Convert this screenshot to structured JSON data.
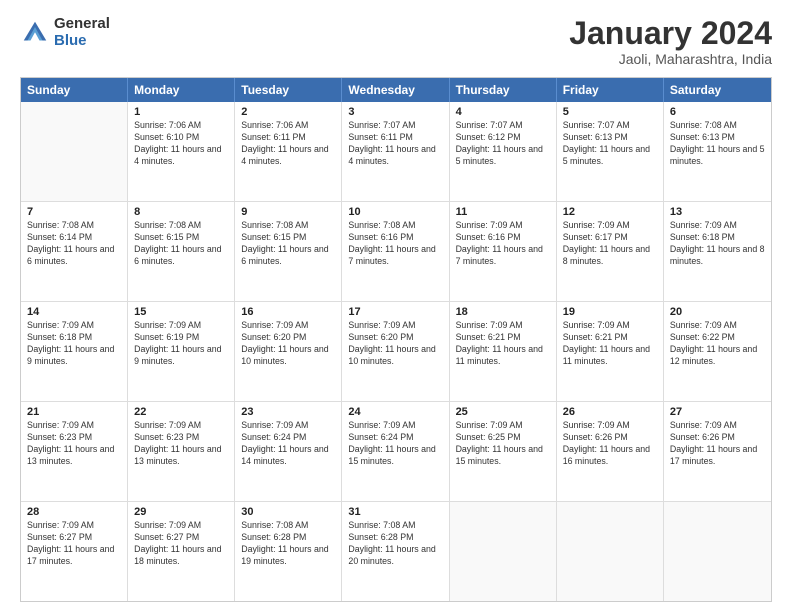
{
  "logo": {
    "general": "General",
    "blue": "Blue"
  },
  "header": {
    "month_year": "January 2024",
    "location": "Jaoli, Maharashtra, India"
  },
  "weekdays": [
    "Sunday",
    "Monday",
    "Tuesday",
    "Wednesday",
    "Thursday",
    "Friday",
    "Saturday"
  ],
  "rows": [
    [
      {
        "day": "",
        "sunrise": "",
        "sunset": "",
        "daylight": ""
      },
      {
        "day": "1",
        "sunrise": "Sunrise: 7:06 AM",
        "sunset": "Sunset: 6:10 PM",
        "daylight": "Daylight: 11 hours and 4 minutes."
      },
      {
        "day": "2",
        "sunrise": "Sunrise: 7:06 AM",
        "sunset": "Sunset: 6:11 PM",
        "daylight": "Daylight: 11 hours and 4 minutes."
      },
      {
        "day": "3",
        "sunrise": "Sunrise: 7:07 AM",
        "sunset": "Sunset: 6:11 PM",
        "daylight": "Daylight: 11 hours and 4 minutes."
      },
      {
        "day": "4",
        "sunrise": "Sunrise: 7:07 AM",
        "sunset": "Sunset: 6:12 PM",
        "daylight": "Daylight: 11 hours and 5 minutes."
      },
      {
        "day": "5",
        "sunrise": "Sunrise: 7:07 AM",
        "sunset": "Sunset: 6:13 PM",
        "daylight": "Daylight: 11 hours and 5 minutes."
      },
      {
        "day": "6",
        "sunrise": "Sunrise: 7:08 AM",
        "sunset": "Sunset: 6:13 PM",
        "daylight": "Daylight: 11 hours and 5 minutes."
      }
    ],
    [
      {
        "day": "7",
        "sunrise": "Sunrise: 7:08 AM",
        "sunset": "Sunset: 6:14 PM",
        "daylight": "Daylight: 11 hours and 6 minutes."
      },
      {
        "day": "8",
        "sunrise": "Sunrise: 7:08 AM",
        "sunset": "Sunset: 6:15 PM",
        "daylight": "Daylight: 11 hours and 6 minutes."
      },
      {
        "day": "9",
        "sunrise": "Sunrise: 7:08 AM",
        "sunset": "Sunset: 6:15 PM",
        "daylight": "Daylight: 11 hours and 6 minutes."
      },
      {
        "day": "10",
        "sunrise": "Sunrise: 7:08 AM",
        "sunset": "Sunset: 6:16 PM",
        "daylight": "Daylight: 11 hours and 7 minutes."
      },
      {
        "day": "11",
        "sunrise": "Sunrise: 7:09 AM",
        "sunset": "Sunset: 6:16 PM",
        "daylight": "Daylight: 11 hours and 7 minutes."
      },
      {
        "day": "12",
        "sunrise": "Sunrise: 7:09 AM",
        "sunset": "Sunset: 6:17 PM",
        "daylight": "Daylight: 11 hours and 8 minutes."
      },
      {
        "day": "13",
        "sunrise": "Sunrise: 7:09 AM",
        "sunset": "Sunset: 6:18 PM",
        "daylight": "Daylight: 11 hours and 8 minutes."
      }
    ],
    [
      {
        "day": "14",
        "sunrise": "Sunrise: 7:09 AM",
        "sunset": "Sunset: 6:18 PM",
        "daylight": "Daylight: 11 hours and 9 minutes."
      },
      {
        "day": "15",
        "sunrise": "Sunrise: 7:09 AM",
        "sunset": "Sunset: 6:19 PM",
        "daylight": "Daylight: 11 hours and 9 minutes."
      },
      {
        "day": "16",
        "sunrise": "Sunrise: 7:09 AM",
        "sunset": "Sunset: 6:20 PM",
        "daylight": "Daylight: 11 hours and 10 minutes."
      },
      {
        "day": "17",
        "sunrise": "Sunrise: 7:09 AM",
        "sunset": "Sunset: 6:20 PM",
        "daylight": "Daylight: 11 hours and 10 minutes."
      },
      {
        "day": "18",
        "sunrise": "Sunrise: 7:09 AM",
        "sunset": "Sunset: 6:21 PM",
        "daylight": "Daylight: 11 hours and 11 minutes."
      },
      {
        "day": "19",
        "sunrise": "Sunrise: 7:09 AM",
        "sunset": "Sunset: 6:21 PM",
        "daylight": "Daylight: 11 hours and 11 minutes."
      },
      {
        "day": "20",
        "sunrise": "Sunrise: 7:09 AM",
        "sunset": "Sunset: 6:22 PM",
        "daylight": "Daylight: 11 hours and 12 minutes."
      }
    ],
    [
      {
        "day": "21",
        "sunrise": "Sunrise: 7:09 AM",
        "sunset": "Sunset: 6:23 PM",
        "daylight": "Daylight: 11 hours and 13 minutes."
      },
      {
        "day": "22",
        "sunrise": "Sunrise: 7:09 AM",
        "sunset": "Sunset: 6:23 PM",
        "daylight": "Daylight: 11 hours and 13 minutes."
      },
      {
        "day": "23",
        "sunrise": "Sunrise: 7:09 AM",
        "sunset": "Sunset: 6:24 PM",
        "daylight": "Daylight: 11 hours and 14 minutes."
      },
      {
        "day": "24",
        "sunrise": "Sunrise: 7:09 AM",
        "sunset": "Sunset: 6:24 PM",
        "daylight": "Daylight: 11 hours and 15 minutes."
      },
      {
        "day": "25",
        "sunrise": "Sunrise: 7:09 AM",
        "sunset": "Sunset: 6:25 PM",
        "daylight": "Daylight: 11 hours and 15 minutes."
      },
      {
        "day": "26",
        "sunrise": "Sunrise: 7:09 AM",
        "sunset": "Sunset: 6:26 PM",
        "daylight": "Daylight: 11 hours and 16 minutes."
      },
      {
        "day": "27",
        "sunrise": "Sunrise: 7:09 AM",
        "sunset": "Sunset: 6:26 PM",
        "daylight": "Daylight: 11 hours and 17 minutes."
      }
    ],
    [
      {
        "day": "28",
        "sunrise": "Sunrise: 7:09 AM",
        "sunset": "Sunset: 6:27 PM",
        "daylight": "Daylight: 11 hours and 17 minutes."
      },
      {
        "day": "29",
        "sunrise": "Sunrise: 7:09 AM",
        "sunset": "Sunset: 6:27 PM",
        "daylight": "Daylight: 11 hours and 18 minutes."
      },
      {
        "day": "30",
        "sunrise": "Sunrise: 7:08 AM",
        "sunset": "Sunset: 6:28 PM",
        "daylight": "Daylight: 11 hours and 19 minutes."
      },
      {
        "day": "31",
        "sunrise": "Sunrise: 7:08 AM",
        "sunset": "Sunset: 6:28 PM",
        "daylight": "Daylight: 11 hours and 20 minutes."
      },
      {
        "day": "",
        "sunrise": "",
        "sunset": "",
        "daylight": ""
      },
      {
        "day": "",
        "sunrise": "",
        "sunset": "",
        "daylight": ""
      },
      {
        "day": "",
        "sunrise": "",
        "sunset": "",
        "daylight": ""
      }
    ]
  ]
}
